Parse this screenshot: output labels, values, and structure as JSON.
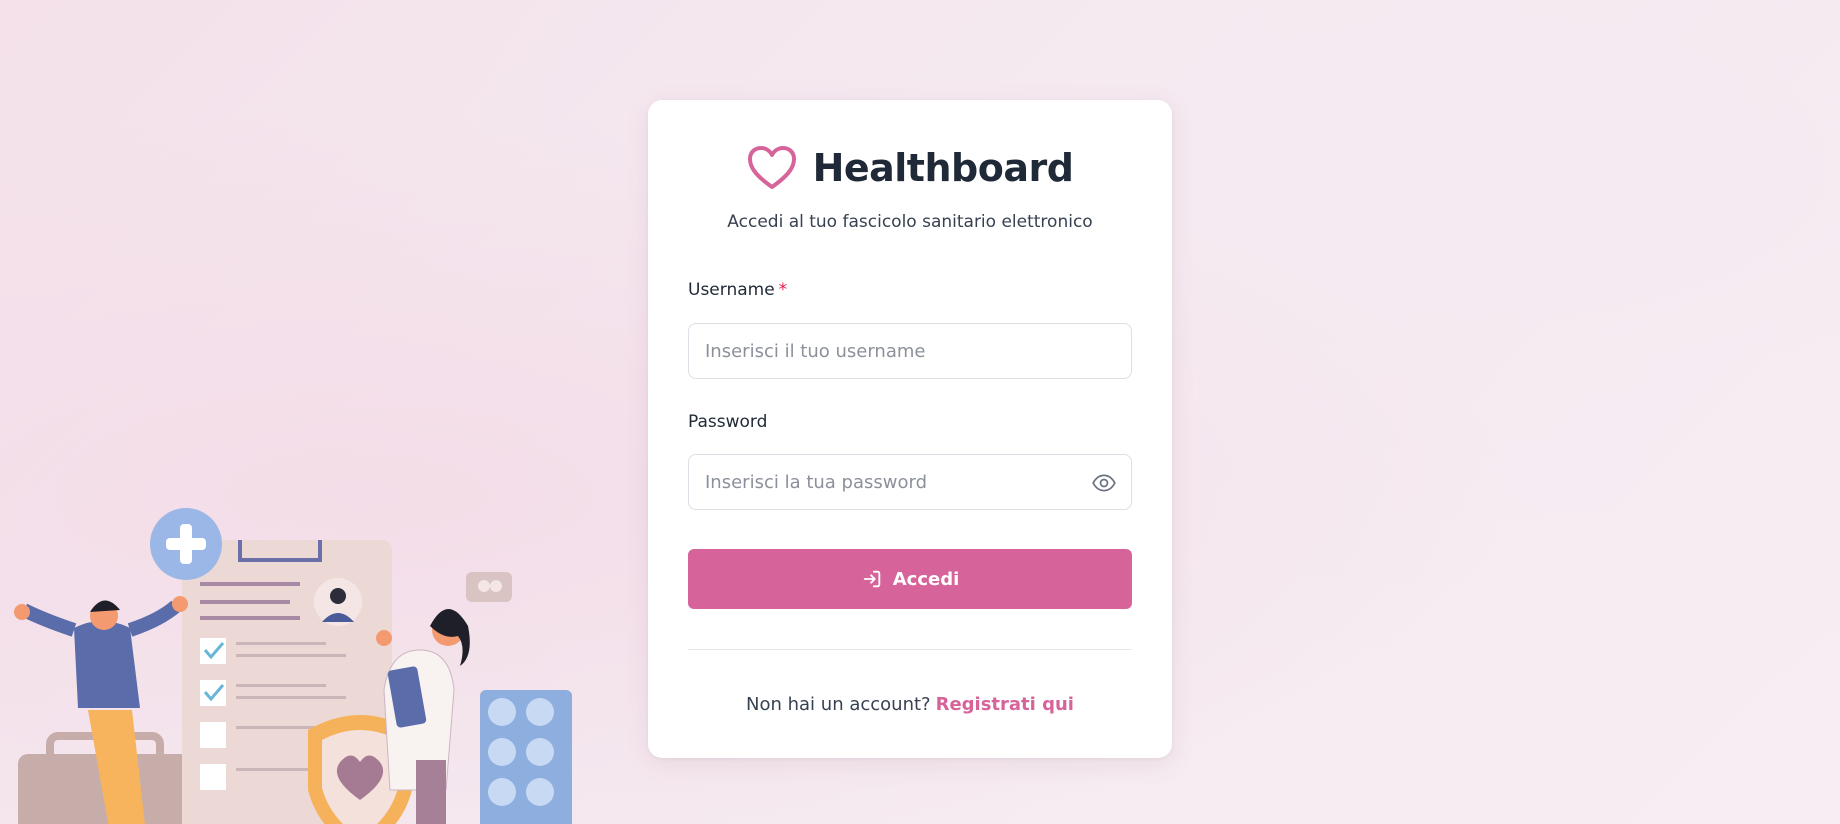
{
  "brand": {
    "title": "Healthboard",
    "icon": "heart-icon",
    "subtitle": "Accedi al tuo fascicolo sanitario elettronico"
  },
  "form": {
    "username": {
      "label": "Username",
      "required_mark": "*",
      "placeholder": "Inserisci il tuo username",
      "value": ""
    },
    "password": {
      "label": "Password",
      "placeholder": "Inserisci la tua password",
      "value": "",
      "toggle_icon": "eye-icon"
    },
    "submit": {
      "label": "Accedi",
      "icon": "login-icon"
    }
  },
  "footer": {
    "prompt": "Non hai un account?",
    "link_label": "Registrati qui"
  },
  "colors": {
    "accent": "#d6649a",
    "title": "#1f2937",
    "required": "#e11d48"
  }
}
